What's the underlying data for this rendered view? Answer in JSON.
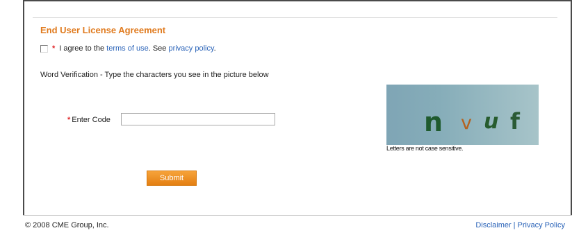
{
  "eula": {
    "title": "End User License Agreement",
    "required_marker": "*",
    "agree_prefix": "I agree to the",
    "terms_link": "terms of use",
    "mid_text": ". See",
    "privacy_link": "privacy policy",
    "end_text": "."
  },
  "verification": {
    "instructions": "Word Verification - Type the characters you see in the picture below",
    "required_marker": "*",
    "code_label": "Enter Code",
    "code_value": "",
    "captcha_chars": [
      "n",
      "v",
      "u",
      "f"
    ],
    "captcha_note": "Letters are not case sensitive."
  },
  "form": {
    "submit_label": "Submit"
  },
  "footer": {
    "copyright": "© 2008 CME Group, Inc.",
    "disclaimer_link": "Disclaimer",
    "separator": "|",
    "privacy_link": "Privacy Policy"
  },
  "colors": {
    "accent": "#e07b1f",
    "link": "#2a63b8",
    "required": "#e0282b"
  }
}
